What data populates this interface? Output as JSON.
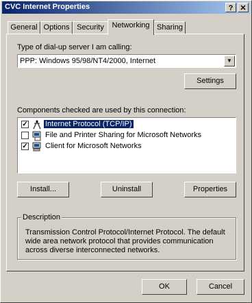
{
  "window": {
    "title": "CVC Internet  Properties"
  },
  "titlebar_buttons": {
    "help": "?",
    "close": "✕"
  },
  "tabs": [
    {
      "label": "General"
    },
    {
      "label": "Options"
    },
    {
      "label": "Security"
    },
    {
      "label": "Networking"
    },
    {
      "label": "Sharing"
    }
  ],
  "server_type": {
    "label": "Type of dial-up server I am calling:",
    "value": "PPP: Windows 95/98/NT4/2000, Internet",
    "settings_button": "Settings"
  },
  "components": {
    "label": "Components checked are used by this connection:",
    "items": [
      {
        "label": "Internet Protocol (TCP/IP)",
        "checked": true,
        "selected": true,
        "icon": "protocol-icon"
      },
      {
        "label": "File and Printer Sharing for Microsoft Networks",
        "checked": false,
        "selected": false,
        "icon": "service-icon"
      },
      {
        "label": "Client for Microsoft Networks",
        "checked": true,
        "selected": false,
        "icon": "client-icon"
      }
    ],
    "install_button": "Install...",
    "uninstall_button": "Uninstall",
    "properties_button": "Properties"
  },
  "description": {
    "title": "Description",
    "text": "Transmission Control Protocol/Internet Protocol. The default wide area network protocol that provides communication across diverse interconnected networks."
  },
  "footer": {
    "ok_button": "OK",
    "cancel_button": "Cancel"
  },
  "colors": {
    "titlebar_start": "#0a246a",
    "titlebar_end": "#a6caf0",
    "face": "#d4d0c8",
    "selection": "#0a246a"
  }
}
